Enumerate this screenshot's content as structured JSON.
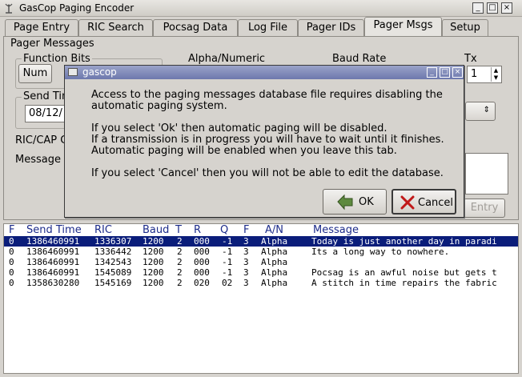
{
  "window": {
    "title": "GasCop Paging Encoder",
    "icon": "antenna-icon"
  },
  "titlebar_buttons": [
    "_",
    "□",
    "×"
  ],
  "tabs": [
    "Page Entry",
    "RIC Search",
    "Pocsag Data",
    "Log File",
    "Pager IDs",
    "Pager Msgs",
    "Setup"
  ],
  "active_tab": "Pager Msgs",
  "panel": {
    "group_title": "Pager Messages",
    "function_bits_label": "Function Bits",
    "num_button": "Num",
    "alpha_label": "Alpha/Numeric",
    "baud_label": "Baud Rate",
    "tx_label": "Tx",
    "tx_value": "1",
    "send_time_label": "Send Tim",
    "send_time_value": "08/12/",
    "ric_label": "RIC/CAP C",
    "message_label": "Message",
    "entry_button": "Entry"
  },
  "list": {
    "columns": [
      "F",
      "Send Time",
      "RIC",
      "Baud",
      "T",
      "R",
      "Q",
      "F",
      "A/N",
      "Message"
    ],
    "rows": [
      [
        "0",
        "1386460991",
        "1336307",
        "1200",
        "2",
        "000",
        "-1",
        "3",
        "Alpha",
        "Today is just another day in paradi"
      ],
      [
        "0",
        "1386460991",
        "1336442",
        "1200",
        "2",
        "000",
        "-1",
        "3",
        "Alpha",
        "Its a long way to nowhere."
      ],
      [
        "0",
        "1386460991",
        "1342543",
        "1200",
        "2",
        "000",
        "-1",
        "3",
        "Alpha",
        ""
      ],
      [
        "0",
        "1386460991",
        "1545089",
        "1200",
        "2",
        "000",
        "-1",
        "3",
        "Alpha",
        "Pocsag is an awful noise but gets t"
      ],
      [
        "0",
        "1358630280",
        "1545169",
        "1200",
        "2",
        "020",
        "02",
        "3",
        "Alpha",
        "A stitch in time repairs the fabric"
      ]
    ],
    "selected_row": 0
  },
  "dialog": {
    "title": "gascop",
    "lines": [
      "Access to the paging messages database file requires disabling the",
      "automatic paging system.",
      "",
      "If you select 'Ok' then automatic paging will be disabled.",
      "If a transmission is in progress you will have to wait until it finishes.",
      "Automatic paging will be enabled when you leave this tab.",
      "",
      "If you select 'Cancel' then you will not be able to edit the database."
    ],
    "ok_label": "OK",
    "cancel_label": "Cancel"
  },
  "colors": {
    "selection": "#0a1d7a",
    "header_text": "#1c2b8a",
    "dialog_titlebar": "#7a84b8"
  }
}
